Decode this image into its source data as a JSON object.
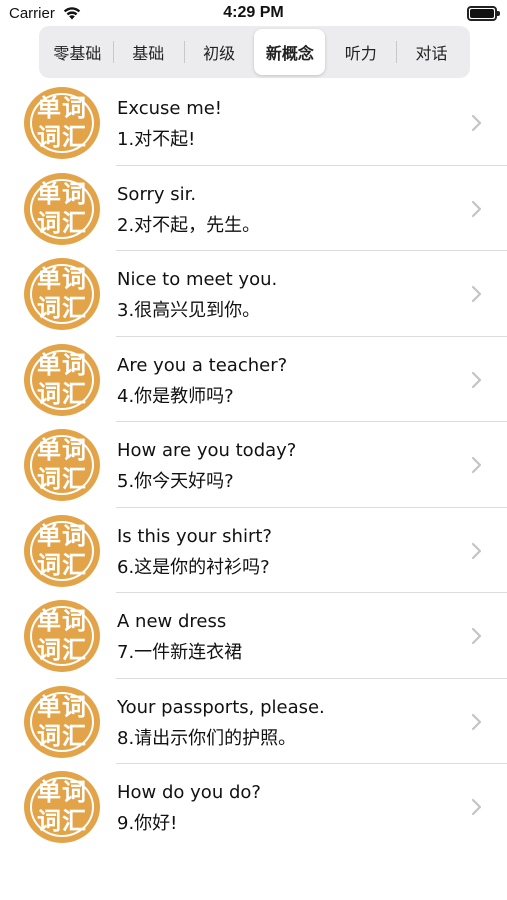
{
  "status_bar": {
    "carrier": "Carrier",
    "time": "4:29 PM"
  },
  "tabs": [
    {
      "label": "零基础",
      "active": false
    },
    {
      "label": "基础",
      "active": false
    },
    {
      "label": "初级",
      "active": false
    },
    {
      "label": "新概念",
      "active": true
    },
    {
      "label": "听力",
      "active": false
    },
    {
      "label": "对话",
      "active": false
    }
  ],
  "avatar_text": {
    "line1": "单词",
    "line2": "词汇"
  },
  "colors": {
    "avatar": "#e3a449",
    "separator": "#dcdcdf",
    "chevron": "#c4c4c7"
  },
  "lessons": [
    {
      "en": "Excuse me!",
      "zh": "1.对不起!"
    },
    {
      "en": "Sorry sir.",
      "zh": "2.对不起，先生。"
    },
    {
      "en": "Nice to meet you.",
      "zh": "3.很高兴见到你。"
    },
    {
      "en": "Are you a teacher?",
      "zh": "4.你是教师吗?"
    },
    {
      "en": "How are you today?",
      "zh": "5.你今天好吗?"
    },
    {
      "en": "Is this your shirt?",
      "zh": "6.这是你的衬衫吗?"
    },
    {
      "en": "A new dress",
      "zh": "7.一件新连衣裙"
    },
    {
      "en": "Your passports, please.",
      "zh": "8.请出示你们的护照。"
    },
    {
      "en": "How do you do?",
      "zh": "9.你好!"
    }
  ]
}
